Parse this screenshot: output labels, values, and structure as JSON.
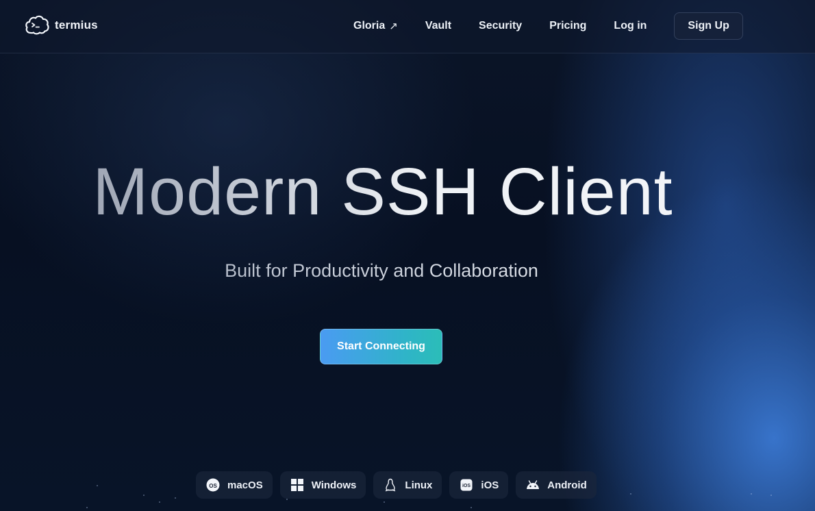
{
  "brand": {
    "name": "termius",
    "icon": "termius-cloud-icon"
  },
  "nav": {
    "links": [
      {
        "label": "Gloria",
        "icon": "external-arrow-icon",
        "arrow": "↗"
      },
      {
        "label": "Vault"
      },
      {
        "label": "Security"
      },
      {
        "label": "Pricing"
      },
      {
        "label": "Log in"
      }
    ],
    "signup_label": "Sign Up"
  },
  "hero": {
    "title": "Modern SSH Client",
    "subtitle": "Built for Productivity and Collaboration",
    "cta_label": "Start Connecting"
  },
  "platforms": [
    {
      "label": "macOS",
      "icon": "macos-icon",
      "icon_text": "OS"
    },
    {
      "label": "Windows",
      "icon": "windows-icon"
    },
    {
      "label": "Linux",
      "icon": "linux-icon"
    },
    {
      "label": "iOS",
      "icon": "ios-icon",
      "icon_text": "iOS"
    },
    {
      "label": "Android",
      "icon": "android-icon"
    }
  ],
  "colors": {
    "background": "#050b18",
    "accent_start": "#4a9bf2",
    "accent_end": "#2bbdb8",
    "glow": "#3a78d2"
  }
}
